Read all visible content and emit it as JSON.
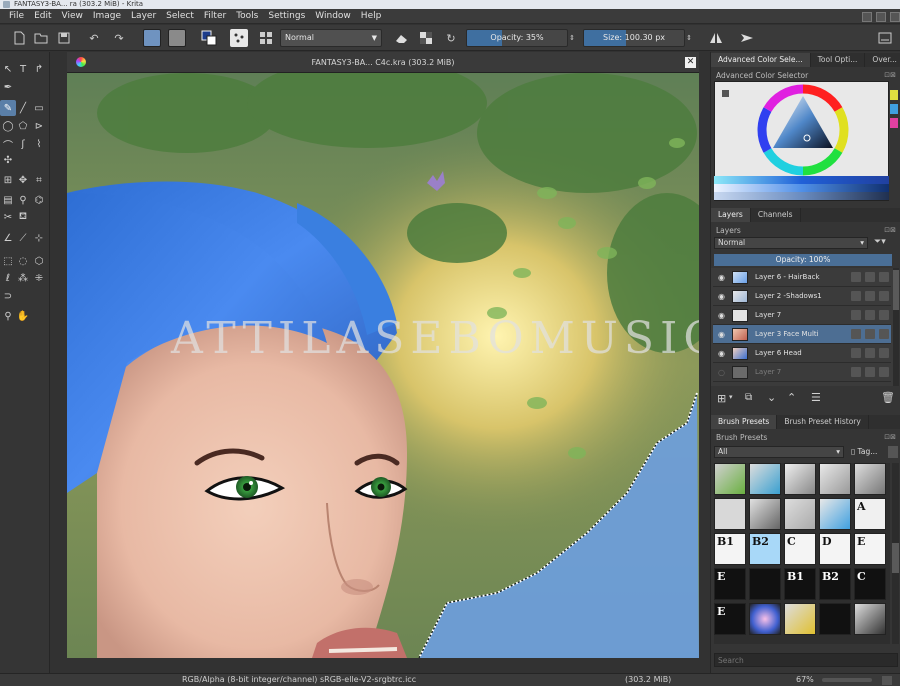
{
  "window": {
    "title": "FANTASY3-BA... ra (303.2 MiB) - Krita"
  },
  "menu": [
    "File",
    "Edit",
    "View",
    "Image",
    "Layer",
    "Select",
    "Filter",
    "Tools",
    "Settings",
    "Window",
    "Help"
  ],
  "toolbar": {
    "blend_mode": "Normal",
    "opacity": {
      "label": "Opacity:",
      "value": "35%",
      "fraction": 0.35
    },
    "size": {
      "label": "Size:",
      "value": "100.30 px",
      "fraction": 0.42
    }
  },
  "document": {
    "tab_title": "FANTASY3-BA... C4c.kra (303.2 MiB)",
    "watermark": "ATTILASEBOMUSIC"
  },
  "dock": {
    "top_tabs": [
      "Advanced Color Sele...",
      "Tool Opti...",
      "Over..."
    ],
    "color_selector_title": "Advanced Color Selector",
    "layer_tabs": [
      "Layers",
      "Channels"
    ],
    "layers_title": "Layers",
    "blend_mode": "Normal",
    "opacity": "Opacity: 100%",
    "layers": [
      {
        "name": "Layer 6 - HairBack",
        "visible": true,
        "selected": false
      },
      {
        "name": "Layer 2 -Shadows1",
        "visible": true,
        "selected": false
      },
      {
        "name": "Layer 7",
        "visible": true,
        "selected": false
      },
      {
        "name": "Layer 3 Face Multi",
        "visible": true,
        "selected": true
      },
      {
        "name": "Layer 6 Head",
        "visible": true,
        "selected": false
      },
      {
        "name": "Layer 7",
        "visible": false,
        "selected": false
      }
    ],
    "brush_tabs": [
      "Brush Presets",
      "Brush Preset History"
    ],
    "brush_presets_title": "Brush Presets",
    "brush_filter": "All",
    "brush_tag_label": "Tag...",
    "brush_letters": [
      "B1",
      "B2",
      "C",
      "D",
      "E",
      "B1",
      "B2",
      "C"
    ],
    "search_placeholder": "Search"
  },
  "status": {
    "color_space": "RGB/Alpha (8-bit integer/channel)  sRGB-elle-V2-srgbtrc.icc",
    "memory": "(303.2 MiB)",
    "zoom": "67%"
  },
  "colors": {
    "accent": "#3f6fa0",
    "hair": "#3a7fe0",
    "selected_layer": "#4d6e93"
  }
}
